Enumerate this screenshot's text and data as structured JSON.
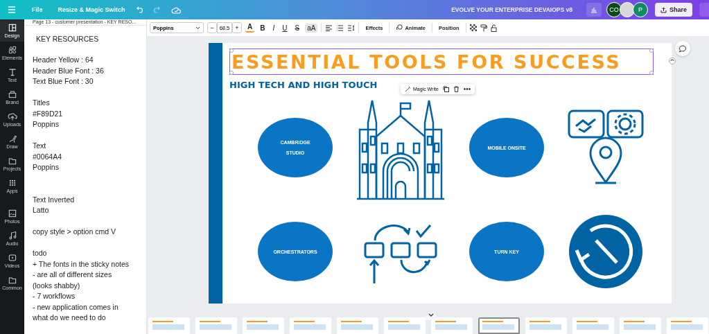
{
  "topbar": {
    "file": "File",
    "resize": "Resize & Magic Switch",
    "title": "EVOLVE YOUR ENTERPRISE DEVAIOPS v8",
    "avatars": [
      {
        "kind": "initials",
        "label": "CO",
        "color": "#0b4a12"
      },
      {
        "kind": "picture",
        "color": "#d8d8d8"
      },
      {
        "kind": "initials",
        "label": "P",
        "color": "#138a66"
      }
    ],
    "share": "Share"
  },
  "rail": [
    {
      "label": "Design",
      "selected": true
    },
    {
      "label": "Elements",
      "selected": false
    },
    {
      "label": "Text",
      "selected": false
    },
    {
      "label": "Brand",
      "selected": false
    },
    {
      "label": "Uploads",
      "selected": false
    },
    {
      "label": "Draw",
      "selected": false
    },
    {
      "label": "Projects",
      "selected": false
    },
    {
      "label": "Apps",
      "selected": false
    },
    {
      "label": "Photos",
      "selected": false
    },
    {
      "label": "Audio",
      "selected": false
    },
    {
      "label": "Videos",
      "selected": false
    },
    {
      "label": "Common",
      "selected": false
    }
  ],
  "notes": {
    "page_title": "Page 13 - customer presentation - KEY RESO...",
    "heading": "KEY RESOURCES",
    "paragraphs": [
      [
        "Header Yellow : 64",
        "Header Blue Font : 36",
        "Text Blue Font : 30"
      ],
      [
        "Titles",
        "#F89D21",
        "Poppins"
      ],
      [
        "Text",
        "#0064A4",
        "Poppins"
      ],
      [
        "Text Inverted",
        "Latto"
      ],
      [
        "copy style > option cmd V"
      ],
      [
        "todo",
        "+ The fonts in the sticky notes",
        "- are all of different sizes",
        "(looks shabby)",
        "- 7 workflows",
        "- new application comes in",
        "what do we need to do"
      ]
    ]
  },
  "toolbar": {
    "font": "Poppins",
    "size": "68.5",
    "minus": "−",
    "plus": "+",
    "color_letter": "A",
    "bold": "B",
    "italic": "I",
    "underline": "U",
    "strike": "S",
    "case": {
      "label": "aA",
      "selected": true
    },
    "effects": "Effects",
    "animate": "Animate",
    "position": "Position"
  },
  "slide": {
    "title": "ESSENTIAL TOOLS FOR SUCCESS",
    "subtitle": "HIGH TECH AND HIGH TOUCH",
    "popup": {
      "magic_write": "Magic Write"
    },
    "tiles": [
      {
        "label": "CAMBRIDGE STUDIO",
        "kind": "cathedral"
      },
      {
        "label": "MOBILE ONSITE",
        "kind": "services"
      },
      {
        "label": "ORCHESTRATORS",
        "kind": "workflow"
      },
      {
        "label": "TURN KEY",
        "kind": "restore"
      }
    ]
  },
  "thumbnails": [
    {
      "selected": false
    },
    {
      "selected": false
    },
    {
      "selected": false
    },
    {
      "selected": false
    },
    {
      "selected": false
    },
    {
      "selected": false
    },
    {
      "selected": false
    },
    {
      "selected": true
    },
    {
      "selected": false
    },
    {
      "selected": false
    },
    {
      "selected": false
    },
    {
      "selected": false
    }
  ]
}
